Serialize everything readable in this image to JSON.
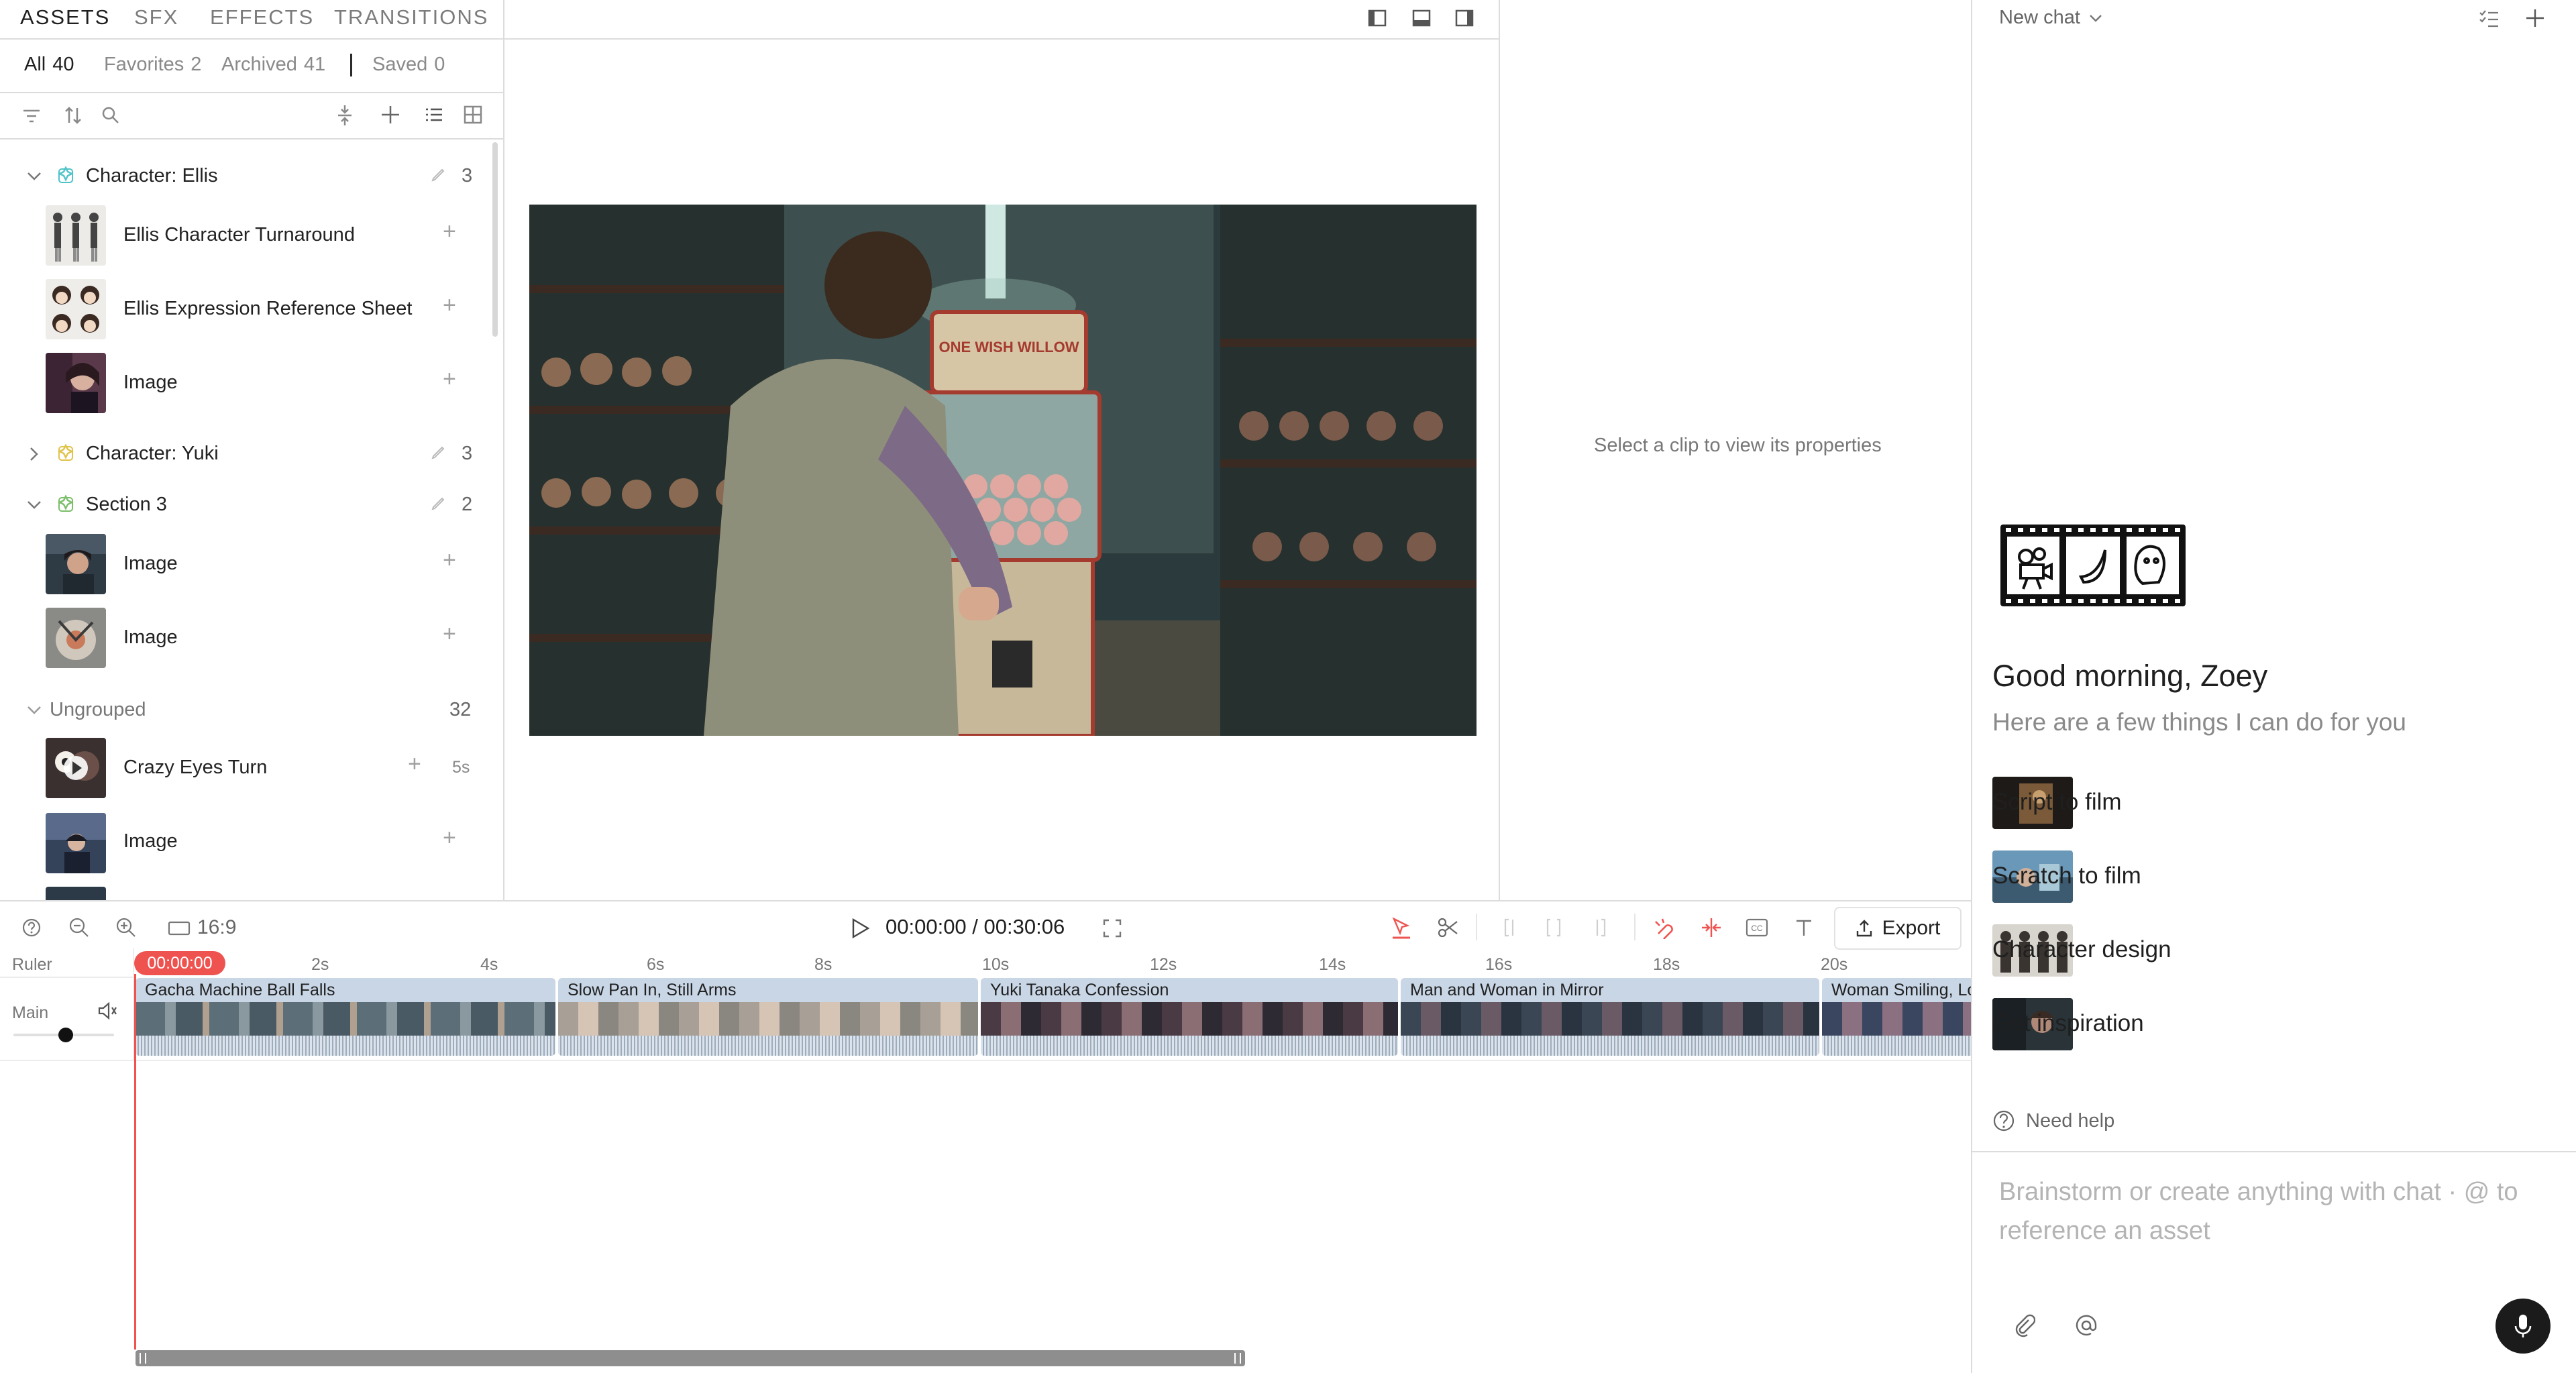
{
  "tabs": [
    "ASSETS",
    "SFX",
    "EFFECTS",
    "TRANSITIONS"
  ],
  "filters": [
    {
      "label": "All",
      "count": "40"
    },
    {
      "label": "Favorites",
      "count": "2"
    },
    {
      "label": "Archived",
      "count": "41"
    },
    {
      "label": "Saved",
      "count": "0"
    }
  ],
  "assets": {
    "groups": [
      {
        "label": "Character: Ellis",
        "count": "3"
      },
      {
        "label": "Character: Yuki",
        "count": "3"
      },
      {
        "label": "Section 3",
        "count": "2"
      },
      {
        "label": "Ungrouped",
        "count": "32"
      }
    ],
    "items": [
      {
        "label": "Ellis Character Turnaround"
      },
      {
        "label": "Ellis Expression Reference Sheet"
      },
      {
        "label": "Image"
      },
      {
        "label": "Image"
      },
      {
        "label": "Image"
      },
      {
        "label": "Crazy Eyes Turn",
        "duration": "5s"
      },
      {
        "label": "Image"
      }
    ]
  },
  "preview": {
    "sign_text": "ONE WISH WILLOW",
    "properties_placeholder": "Select a clip to view its properties"
  },
  "toolbar": {
    "aspect": "16:9",
    "timecode": "00:00:00 / 00:30:06",
    "export_label": "Export"
  },
  "timeline": {
    "ruler_label": "Ruler",
    "track_label": "Main",
    "playhead_time": "00:00:00",
    "ticks": [
      "2s",
      "4s",
      "6s",
      "8s",
      "10s",
      "12s",
      "14s",
      "16s",
      "18s",
      "20s"
    ],
    "clips": [
      {
        "title": "Gacha Machine Ball Falls"
      },
      {
        "title": "Slow Pan In, Still Arms"
      },
      {
        "title": "Yuki Tanaka Confession"
      },
      {
        "title": "Man and Woman in Mirror"
      },
      {
        "title": "Woman Smiling, Lo"
      }
    ]
  },
  "chat": {
    "new_chat": "New chat",
    "greeting": "Good morning, Zoey",
    "subtitle": "Here are a few things I can do for you",
    "suggestions": [
      {
        "label": "Script to film"
      },
      {
        "label": "Scratch to film"
      },
      {
        "label": "Character design"
      },
      {
        "label": "Get inspiration"
      }
    ],
    "need_help": "Need help",
    "input_placeholder": "Brainstorm or create anything with chat · @ to reference an asset"
  },
  "colors": {
    "accent_red": "#ef5350",
    "group_icon_teal": "#4fc3c8",
    "group_icon_yellow": "#e0c34a",
    "group_icon_green": "#7cbf6a",
    "clip_bg": "#c9d6e6"
  }
}
